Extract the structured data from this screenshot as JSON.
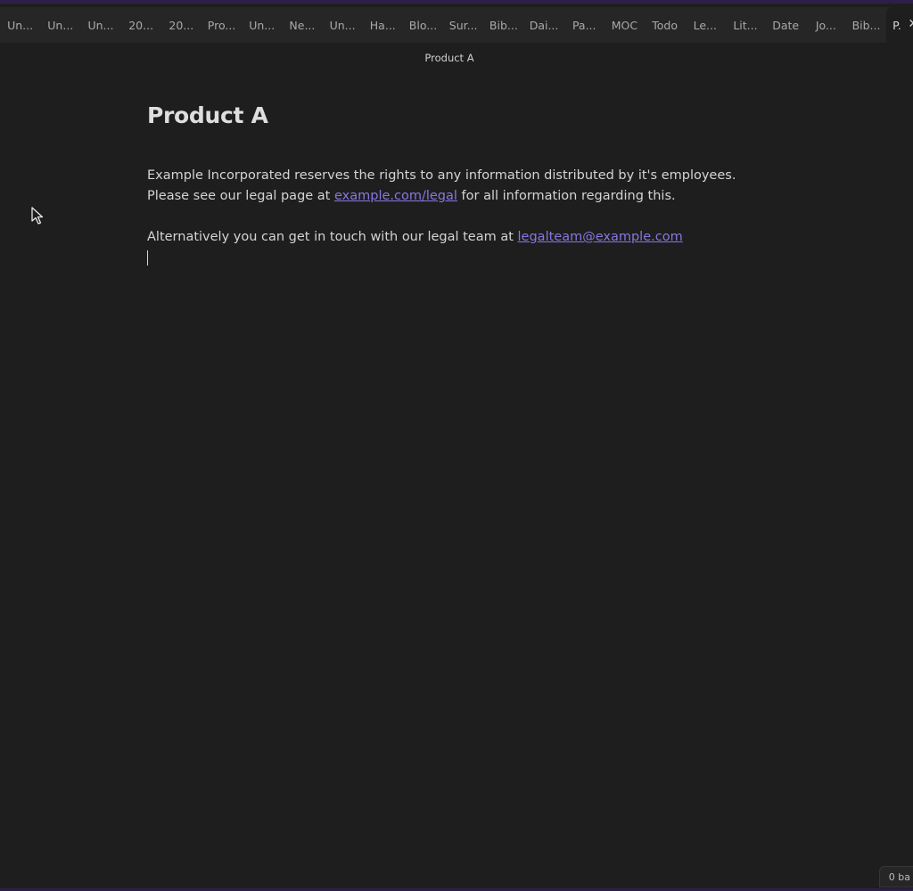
{
  "tabs": [
    {
      "label": "Un..."
    },
    {
      "label": "Un..."
    },
    {
      "label": "Un..."
    },
    {
      "label": "20..."
    },
    {
      "label": "20..."
    },
    {
      "label": "Pro..."
    },
    {
      "label": "Un..."
    },
    {
      "label": "Ne..."
    },
    {
      "label": "Un..."
    },
    {
      "label": "Ha..."
    },
    {
      "label": "Blo..."
    },
    {
      "label": "Sur..."
    },
    {
      "label": "Bib..."
    },
    {
      "label": "Dai..."
    },
    {
      "label": "Pa..."
    },
    {
      "label": "MOC"
    },
    {
      "label": "Todo"
    },
    {
      "label": "Le..."
    },
    {
      "label": "Lit..."
    },
    {
      "label": "Date"
    },
    {
      "label": "Jo..."
    },
    {
      "label": "Bib..."
    }
  ],
  "active_tab": {
    "label": "P.",
    "close_icon": "✕"
  },
  "view_header": {
    "title": "Product A"
  },
  "note": {
    "title": "Product A",
    "line1": "Example Incorporated reserves the rights to any information distributed by it's employees.",
    "line2_prefix": "Please see our legal page at ",
    "line2_link": "example.com/legal",
    "line2_suffix": " for all information regarding this.",
    "line3_prefix": "Alternatively you can get in touch with our legal team at ",
    "line3_link": "legalteam@example.com"
  },
  "status_bar": {
    "backlinks": "0 ba"
  },
  "colors": {
    "background": "#1e1e1e",
    "tab_bar": "#262626",
    "link": "#8a76e0",
    "frame_accent": "#2b1f4a"
  }
}
